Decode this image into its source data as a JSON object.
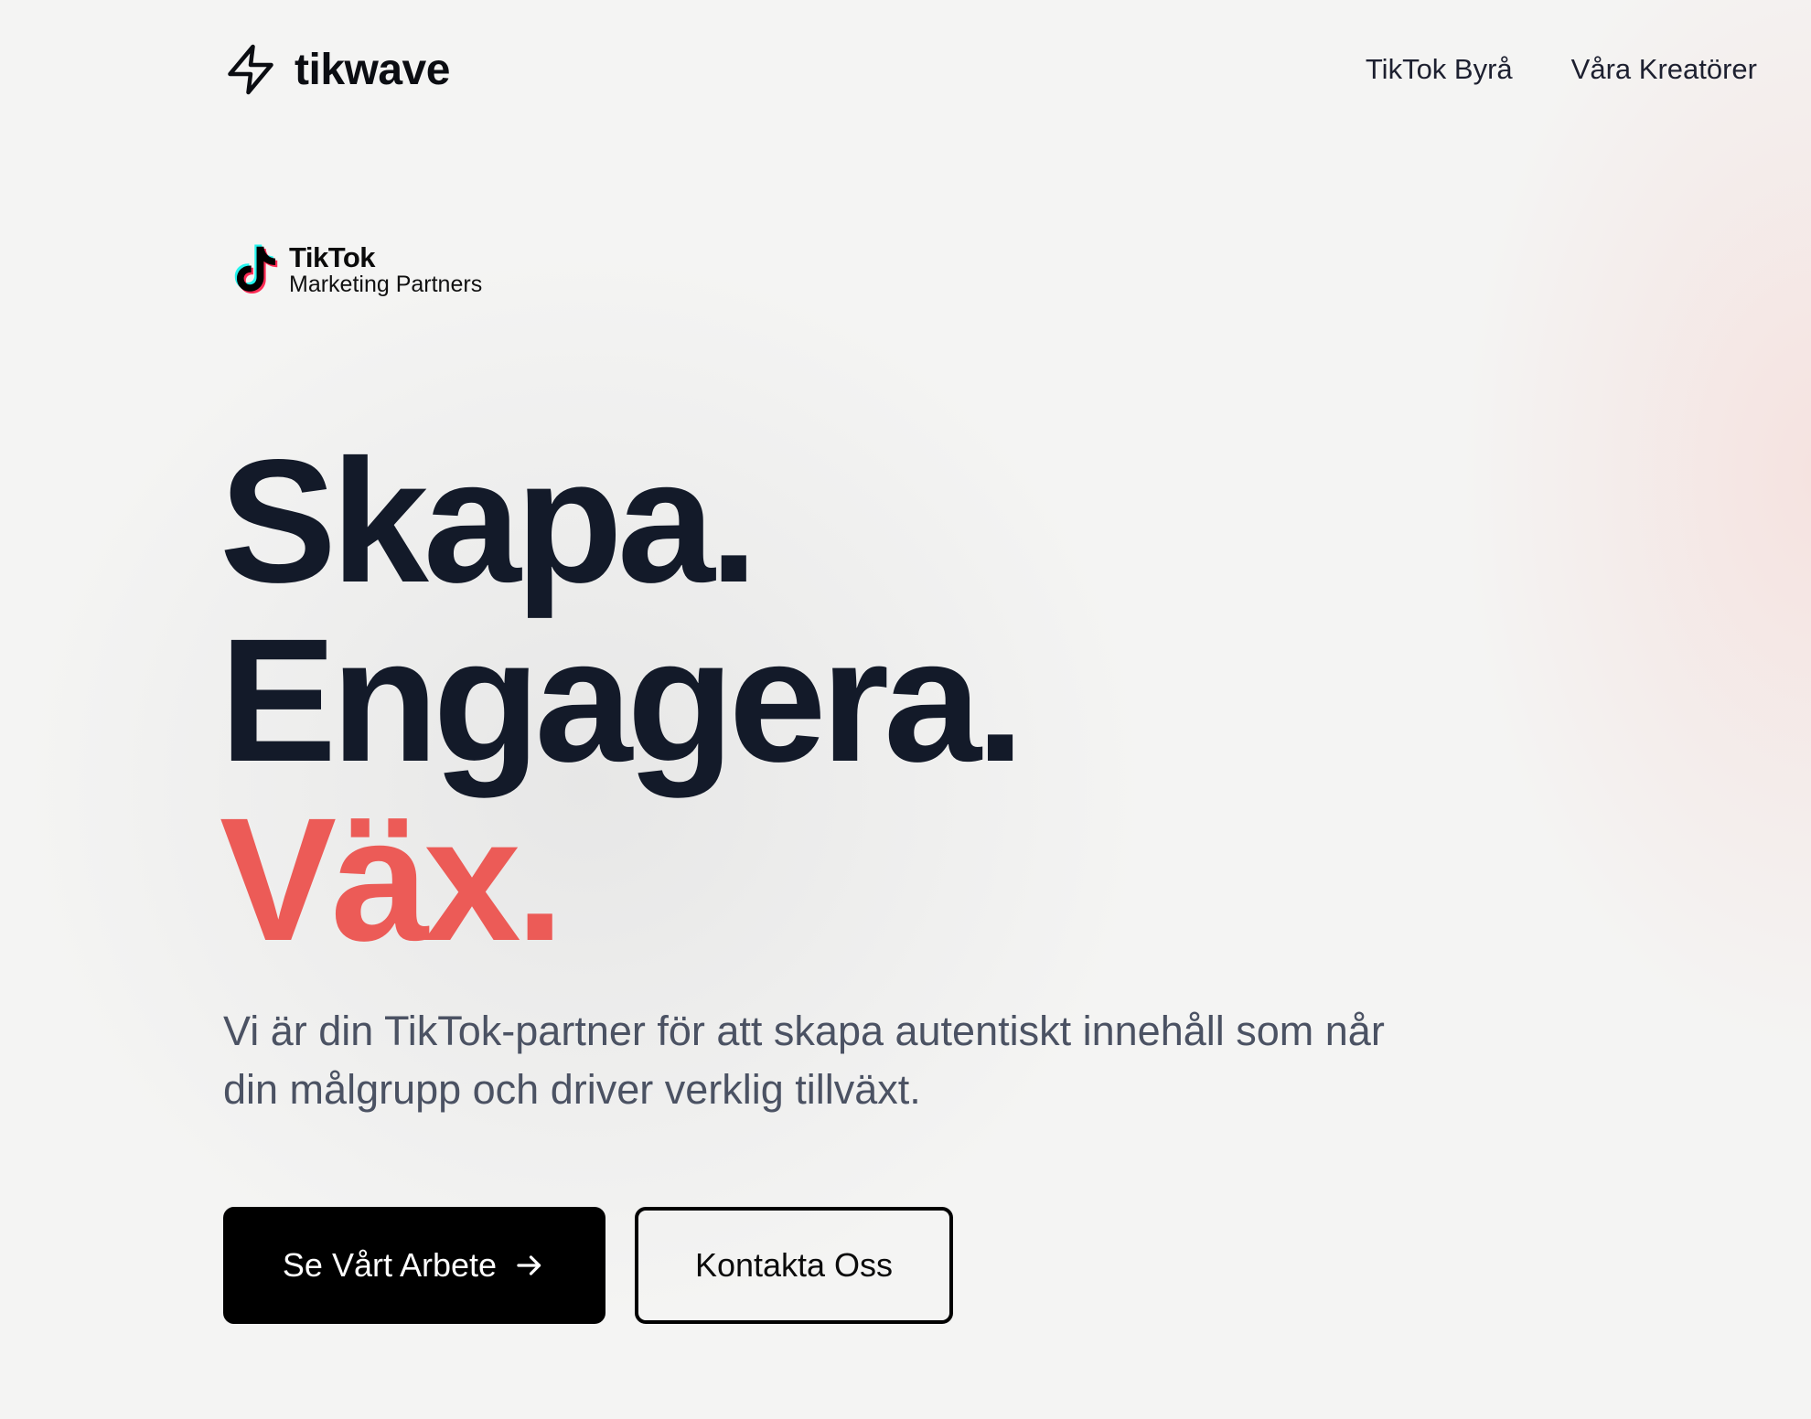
{
  "header": {
    "brand_name": "tikwave",
    "brand_icon": "lightning-bolt-icon",
    "nav": [
      {
        "label": "TikTok Byrå"
      },
      {
        "label": "Våra Kreatörer"
      }
    ]
  },
  "partner_badge": {
    "icon": "tiktok-logo-icon",
    "title": "TikTok",
    "subtitle": "Marketing Partners"
  },
  "hero": {
    "headline": [
      "Skapa.",
      "Engagera.",
      "Väx."
    ],
    "description": "Vi är din TikTok-partner för att skapa autentiskt innehåll som når din målgrupp och driver verklig tillväxt.",
    "primary_button": {
      "label": "Se Vårt Arbete",
      "icon": "arrow-right-icon"
    },
    "secondary_button": {
      "label": "Kontakta Oss"
    }
  },
  "colors": {
    "accent": "#ec5b57",
    "heading": "#131a29",
    "body_text": "#4b5263",
    "background": "#f4f4f3"
  }
}
